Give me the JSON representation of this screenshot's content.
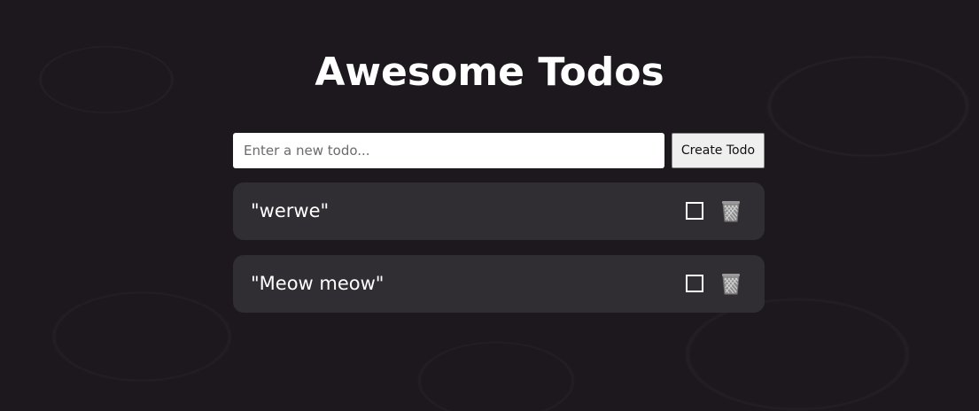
{
  "header": {
    "title": "Awesome Todos"
  },
  "form": {
    "placeholder": "Enter a new todo...",
    "value": "",
    "create_label": "Create Todo"
  },
  "todos": [
    {
      "text": "\"werwe\"",
      "completed": false,
      "delete_icon": "trash-icon"
    },
    {
      "text": "\"Meow meow\"",
      "completed": false,
      "delete_icon": "trash-icon"
    }
  ],
  "colors": {
    "background": "#1c181d",
    "card": "#302d33",
    "text": "#ffffff"
  }
}
